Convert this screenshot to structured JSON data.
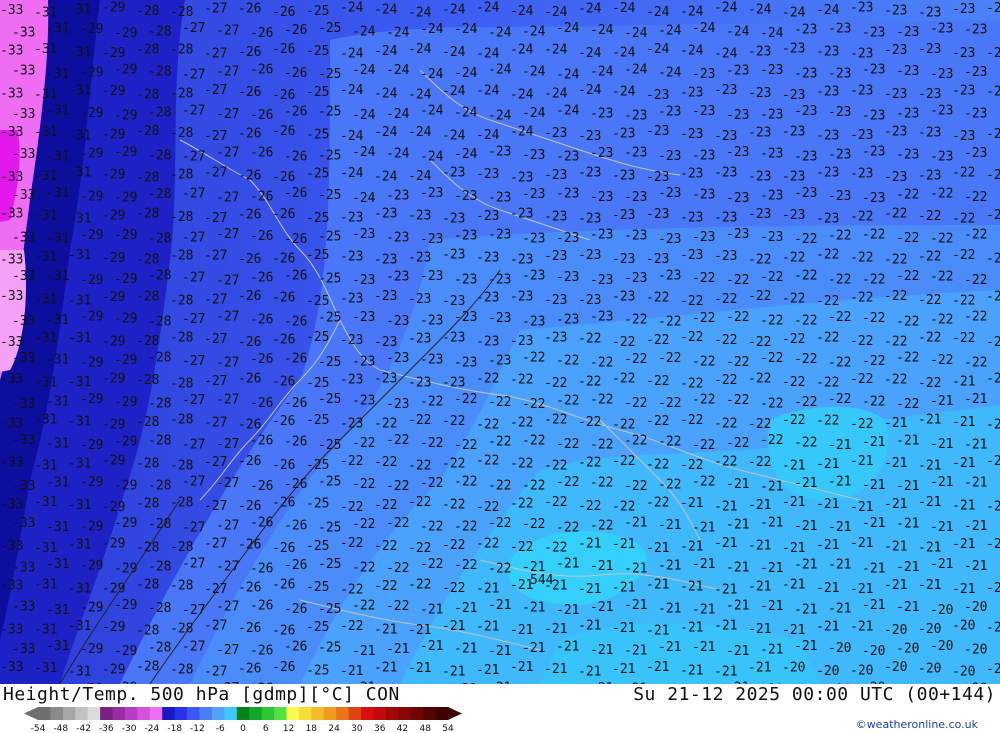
{
  "map": {
    "low_label": "544",
    "iso_values": [
      "-34",
      "-33",
      "-32",
      "-31",
      "-30",
      "-29",
      "-28",
      "-27",
      "-26",
      "-25",
      "-24",
      "-23",
      "-22",
      "-21",
      "-20"
    ],
    "coast_color": "#c4c4c4",
    "border_color": "#222222"
  },
  "footer": {
    "product_title": "Height/Temp. 500 hPa [gdmp][°C] CON",
    "valid_time": "Su 21-12 2025 00:00 UTC (00+144)",
    "credit": "©weatheronline.co.uk"
  },
  "legend": {
    "ticks": [
      "-54",
      "-48",
      "-42",
      "-36",
      "-30",
      "-24",
      "-18",
      "-12",
      "-6",
      "0",
      "6",
      "12",
      "18",
      "24",
      "30",
      "36",
      "42",
      "48",
      "54"
    ],
    "colors": [
      "#6e6e6e",
      "#8a8a8a",
      "#a6a6a6",
      "#c2c2c2",
      "#dcdcdc",
      "#7b1f82",
      "#9a2ba3",
      "#b83cc4",
      "#d552e0",
      "#ee70f4",
      "#1818c4",
      "#2832e6",
      "#3a57f4",
      "#4a7ef9",
      "#4fa3fc",
      "#3fc6fb",
      "#04821a",
      "#10a82a",
      "#2cc635",
      "#56e043",
      "#fafa50",
      "#f6dd3a",
      "#f2bc2c",
      "#f09a20",
      "#ea7418",
      "#e04410",
      "#d80f0f",
      "#bf0b0b",
      "#a30808",
      "#880606",
      "#6e0404",
      "#550202",
      "#3e0101"
    ]
  }
}
